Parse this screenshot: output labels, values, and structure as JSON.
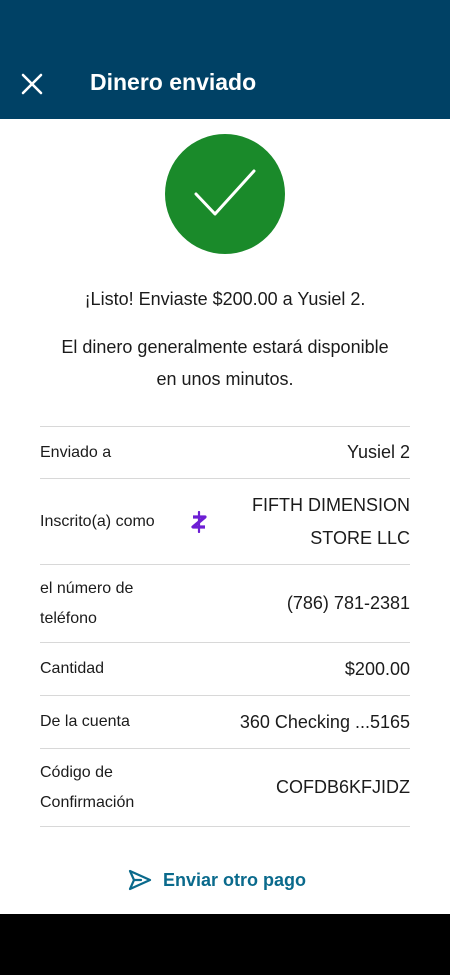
{
  "header": {
    "title": "Dinero enviado",
    "close_icon": "close-icon",
    "background_color": "#004165"
  },
  "status": {
    "icon": "check-icon",
    "color": "#1a8a2a",
    "message": "¡Listo! Enviaste $200.00 a Yusiel 2.",
    "sub_message": "El dinero generalmente estará disponible en unos minutos."
  },
  "details": [
    {
      "label": "Enviado a",
      "value": "Yusiel 2"
    },
    {
      "label": "Inscrito(a) como",
      "value": "FIFTH DIMENSION STORE LLC",
      "icon": "zelle-icon"
    },
    {
      "label": "el número de teléfono",
      "value": "(786) 781-2381"
    },
    {
      "label": "Cantidad",
      "value": "$200.00"
    },
    {
      "label": "De la cuenta",
      "value": "360 Checking ...5165"
    },
    {
      "label": "Código de Confirmación",
      "value": "COFDB6KFJIDZ"
    }
  ],
  "actions": {
    "send_again_label": "Enviar otro pago",
    "send_icon": "send-icon",
    "accent_color": "#0a6a8c"
  }
}
